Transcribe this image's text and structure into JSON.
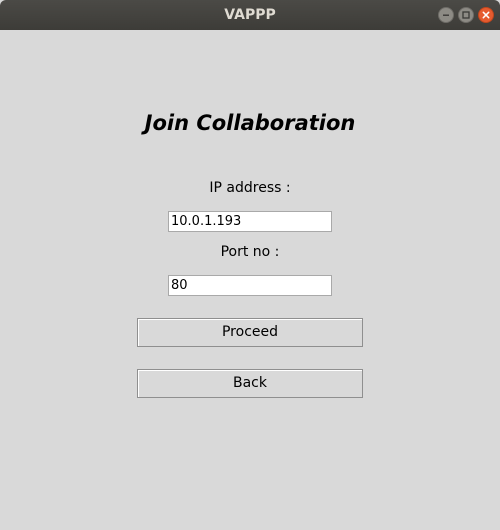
{
  "window": {
    "title": "VAPPP",
    "controls": {
      "minimize_icon": "minimize-icon",
      "maximize_icon": "maximize-icon",
      "close_icon": "close-icon",
      "close_color": "#e65b2f"
    }
  },
  "form": {
    "heading": "Join Collaboration",
    "ip_label": "IP address :",
    "ip_value": "10.0.1.193",
    "port_label": "Port no :",
    "port_value": "80",
    "proceed_label": "Proceed",
    "back_label": "Back"
  }
}
